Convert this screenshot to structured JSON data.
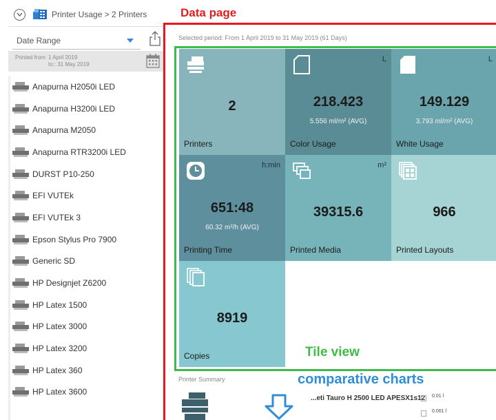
{
  "header": {
    "breadcrumb": "Printer Usage > 2 Printers"
  },
  "sidebar": {
    "date_range_label": "Date Range",
    "printed_from": "Printed from: 1 April 2019",
    "printed_to": "to:: 31 May 2019",
    "printers": [
      "Anapurna H2050i LED",
      "Anapurna H3200i LED",
      "Anapurna M2050",
      "Anapurna RTR3200i LED",
      "DURST P10-250",
      "EFI VUTEk",
      "EFI VUTEk 3",
      "Epson Stylus Pro 7900",
      "Generic SD",
      "HP Designjet Z6200",
      "HP Latex 1500",
      "HP Latex 3000",
      "HP Latex 3200",
      "HP Latex 360",
      "HP Latex 3600"
    ]
  },
  "annotations": {
    "data_page": "Data page",
    "tile_view": "Tile view",
    "comparative_charts": "comparative charts"
  },
  "main": {
    "selected_period": "Selected period: From 1 April 2019 to 31 May 2019 (61 Days)",
    "tiles": {
      "printers": {
        "label": "Printers",
        "value": "2",
        "unit": "",
        "sub": ""
      },
      "color": {
        "label": "Color Usage",
        "value": "218.423",
        "unit": "L",
        "sub": "5.556 ml/m² (AVG)"
      },
      "white": {
        "label": "White Usage",
        "value": "149.129",
        "unit": "L",
        "sub": "3.793 ml/m² (AVG)"
      },
      "time": {
        "label": "Printing Time",
        "value": "651:48",
        "unit": "h:min",
        "sub": "60.32 m²/h (AVG)"
      },
      "media": {
        "label": "Printed Media",
        "value": "39315.6",
        "unit": "m²",
        "sub": ""
      },
      "layouts": {
        "label": "Printed Layouts",
        "value": "966",
        "unit": "",
        "sub": ""
      },
      "copies": {
        "label": "Copies",
        "value": "8919",
        "unit": "",
        "sub": ""
      }
    },
    "summary": {
      "title": "Printer Summary",
      "row_name": "...eti Tauro H 2500 LED APESX1s12",
      "value1": "0.01 l",
      "value2": "0.001 l"
    }
  },
  "colors": {
    "annotation_red": "#e8171d",
    "annotation_green": "#3dbb4c",
    "annotation_blue": "#2f8ed6",
    "accent": "#3a86d6"
  }
}
